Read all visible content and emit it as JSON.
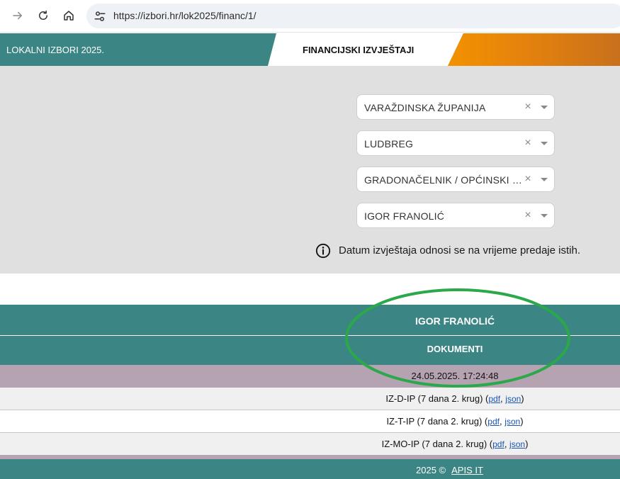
{
  "browser": {
    "url": "https://izbori.hr/lok2025/financ/1/",
    "back_icon": "arrow-right-icon",
    "reload_icon": "reload-icon",
    "home_icon": "home-icon",
    "site_info_icon": "tune-icon"
  },
  "header": {
    "left_title": "LOKALNI IZBORI 2025.",
    "active_tab": "FINANCIJSKI IZVJEŠTAJI",
    "accent_color": "#3b8584",
    "highlight_color": "#f39200"
  },
  "filters": [
    {
      "value": "VARAŽDINSKA ŽUPANIJA",
      "clear": "×"
    },
    {
      "value": "LUDBREG",
      "clear": "×"
    },
    {
      "value": "GRADONAČELNIK / OPĆINSKI NAČELNIK",
      "clear": "×"
    },
    {
      "value": "IGOR FRANOLIĆ",
      "clear": "×"
    }
  ],
  "info": {
    "icon": "info-icon",
    "text": "Datum izvještaja odnosi se na vrijeme predaje istih."
  },
  "results": {
    "candidate": "IGOR FRANOLIĆ",
    "documents_header": "DOKUMENTI",
    "date": "24.05.2025. 17:24:48",
    "documents": [
      {
        "name": "IZ-D-IP (7 dana 2. krug)",
        "pdf": "pdf",
        "json": "json"
      },
      {
        "name": "IZ-T-IP (7 dana 2. krug)",
        "pdf": "pdf",
        "json": "json"
      },
      {
        "name": "IZ-MO-IP (7 dana 2. krug)",
        "pdf": "pdf",
        "json": "json"
      }
    ]
  },
  "footer": {
    "copyright": "2025 ©",
    "link": "APIS IT"
  },
  "annotation": {
    "color": "#2aa84a"
  }
}
